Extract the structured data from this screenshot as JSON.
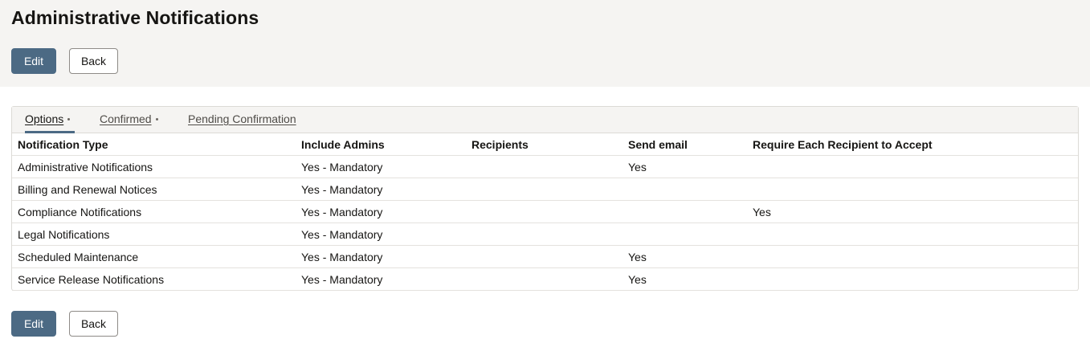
{
  "header": {
    "title": "Administrative Notifications",
    "edit_label": "Edit",
    "back_label": "Back"
  },
  "tabs": [
    {
      "label": "Options",
      "active": true
    },
    {
      "label": "Confirmed",
      "active": false
    },
    {
      "label": "Pending Confirmation",
      "active": false
    }
  ],
  "table": {
    "columns": [
      "Notification Type",
      "Include Admins",
      "Recipients",
      "Send email",
      "Require Each Recipient to Accept"
    ],
    "rows": [
      [
        "Administrative Notifications",
        "Yes - Mandatory",
        "",
        "Yes",
        ""
      ],
      [
        "Billing and Renewal Notices",
        "Yes - Mandatory",
        "",
        "",
        ""
      ],
      [
        "Compliance Notifications",
        "Yes - Mandatory",
        "",
        "",
        "Yes"
      ],
      [
        "Legal Notifications",
        "Yes - Mandatory",
        "",
        "",
        ""
      ],
      [
        "Scheduled Maintenance",
        "Yes - Mandatory",
        "",
        "Yes",
        ""
      ],
      [
        "Service Release Notifications",
        "Yes - Mandatory",
        "",
        "Yes",
        ""
      ]
    ]
  },
  "footer": {
    "edit_label": "Edit",
    "back_label": "Back"
  },
  "colors": {
    "primary_button": "#4c6a84",
    "header_bg": "#f5f4f2"
  }
}
